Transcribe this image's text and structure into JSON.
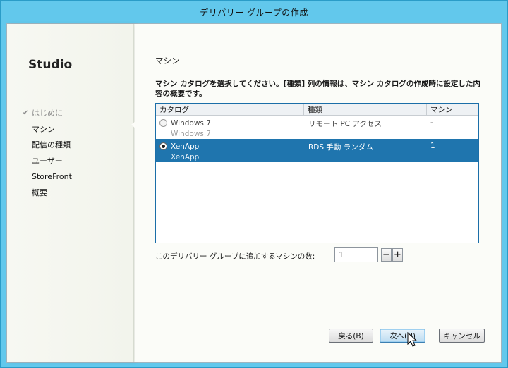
{
  "window": {
    "title": "デリバリー グループの作成"
  },
  "sidebar": {
    "brand": "Studio",
    "steps": [
      {
        "label": "はじめに",
        "state": "done",
        "check": "✔"
      },
      {
        "label": "マシン",
        "state": "current",
        "check": ""
      },
      {
        "label": "配信の種類",
        "state": "pending",
        "check": ""
      },
      {
        "label": "ユーザー",
        "state": "pending",
        "check": ""
      },
      {
        "label": "StoreFront",
        "state": "pending",
        "check": ""
      },
      {
        "label": "概要",
        "state": "pending",
        "check": ""
      }
    ]
  },
  "main": {
    "heading": "マシン",
    "instruction": "マシン カタログを選択してください。[種類] 列の情報は、マシン カタログの作成時に設定した内容の概要です。",
    "table": {
      "columns": [
        "カタログ",
        "種類",
        "マシン"
      ],
      "rows": [
        {
          "name": "Windows 7",
          "description": "Windows 7",
          "type": "リモート PC アクセス",
          "machines": "-",
          "selected": false
        },
        {
          "name": "XenApp",
          "description": "XenApp",
          "type": "RDS 手動 ランダム",
          "machines": "1",
          "selected": true
        }
      ]
    },
    "count_label": "このデリバリー グループに追加するマシンの数:",
    "count_value": "1",
    "decrement": "−",
    "increment": "+"
  },
  "footer": {
    "back_label": "戻る(B)",
    "next_label": "次へ(N)",
    "cancel_label": "キャンセル"
  },
  "colors": {
    "selection": "#1f75ae",
    "titlebar": "#62c8ec"
  }
}
